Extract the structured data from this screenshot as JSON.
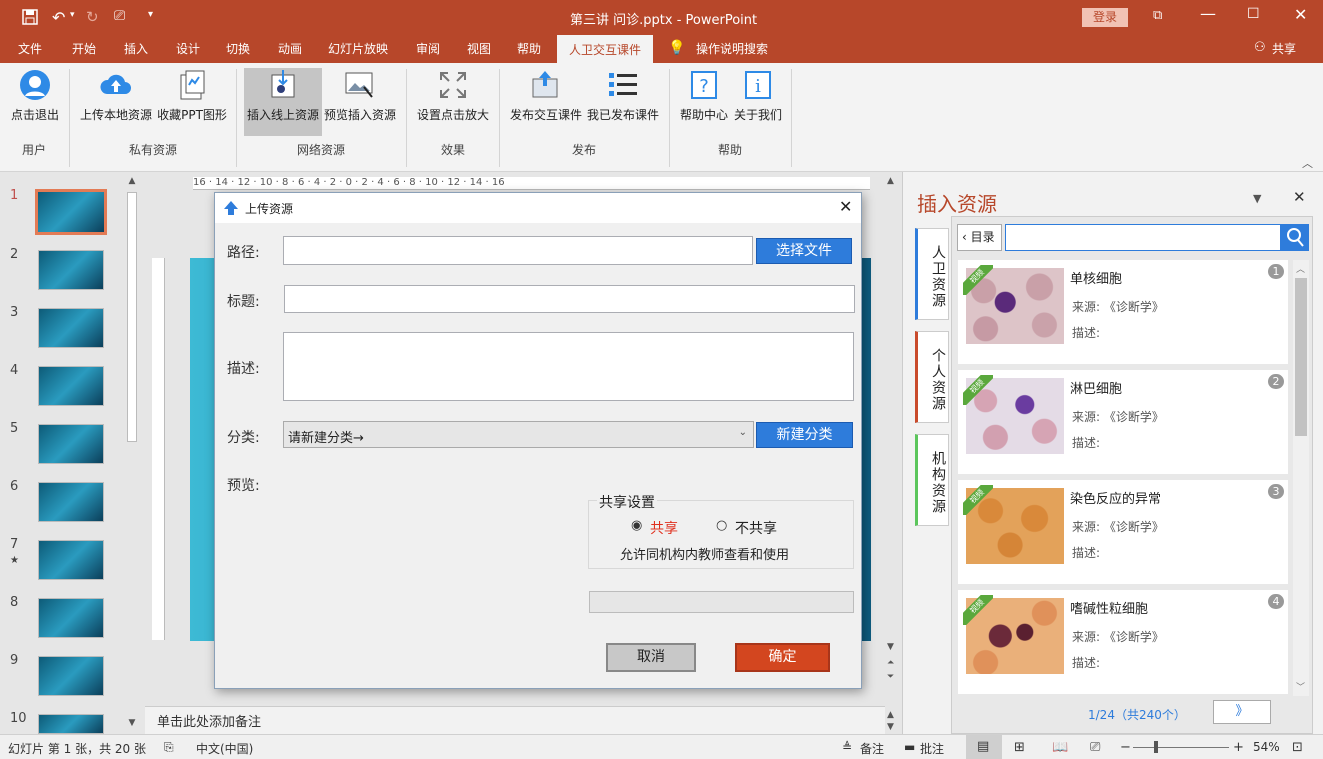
{
  "title_bar": {
    "title": "第三讲 问诊.pptx  -  PowerPoint",
    "login": "登录"
  },
  "tabs": [
    "文件",
    "开始",
    "插入",
    "设计",
    "切换",
    "动画",
    "幻灯片放映",
    "审阅",
    "视图",
    "帮助",
    "人卫交互课件"
  ],
  "tell_me": "操作说明搜索",
  "share": "共享",
  "ribbon": {
    "groups": [
      {
        "label": "用户",
        "buttons": [
          "点击退出"
        ]
      },
      {
        "label": "私有资源",
        "buttons": [
          "上传本地资源",
          "收藏PPT图形"
        ]
      },
      {
        "label": "网络资源",
        "buttons": [
          "插入线上资源",
          "预览插入资源"
        ]
      },
      {
        "label": "效果",
        "buttons": [
          "设置点击放大"
        ]
      },
      {
        "label": "发布",
        "buttons": [
          "发布交互课件",
          "我已发布课件"
        ]
      },
      {
        "label": "帮助",
        "buttons": [
          "帮助中心",
          "关于我们"
        ]
      }
    ]
  },
  "slides": [
    {
      "num": "1",
      "mark": ""
    },
    {
      "num": "2",
      "mark": ""
    },
    {
      "num": "3",
      "mark": ""
    },
    {
      "num": "4",
      "mark": ""
    },
    {
      "num": "5",
      "mark": ""
    },
    {
      "num": "6",
      "mark": ""
    },
    {
      "num": "7",
      "mark": "★"
    },
    {
      "num": "8",
      "mark": ""
    },
    {
      "num": "9",
      "mark": ""
    },
    {
      "num": "10",
      "mark": ""
    }
  ],
  "ruler_text": "16 · 14 · 12 · 10 · 8 · 6 · 4 · 2 · 0 · 2 · 4 · 6 · 8 · 10 · 12 · 14 · 16",
  "notes_placeholder": "单击此处添加备注",
  "dialog": {
    "title": "上传资源",
    "path_label": "路径:",
    "path_value": "",
    "choose_file": "选择文件",
    "title_label": "标题:",
    "title_value": "",
    "desc_label": "描述:",
    "desc_value": "",
    "category_label": "分类:",
    "category_value": "请新建分类→",
    "new_category": "新建分类",
    "preview_label": "预览:",
    "share_settings": "共享设置",
    "share_option": "共享",
    "noshare_option": "不共享",
    "share_hint": "允许同机构内教师查看和使用",
    "cancel": "取消",
    "ok": "确定",
    "progress": 0
  },
  "pane": {
    "title": "插入资源",
    "back": "目录",
    "search_value": "",
    "side_tabs": [
      {
        "label": "人卫资源",
        "color": "#2e7cdb"
      },
      {
        "label": "个人资源",
        "color": "#c94b2c"
      },
      {
        "label": "机构资源",
        "color": "#5cc65c"
      }
    ],
    "tag": "视频",
    "source_label": "来源:",
    "source_value": "《诊断学》",
    "desc_label": "描述:",
    "items": [
      {
        "num": "1",
        "title": "单核细胞"
      },
      {
        "num": "2",
        "title": "淋巴细胞"
      },
      {
        "num": "3",
        "title": "染色反应的异常"
      },
      {
        "num": "4",
        "title": "嗜碱性粒细胞"
      }
    ],
    "pagination": "1/24（共240个）",
    "next": "》"
  },
  "status": {
    "slide_info": "幻灯片 第 1 张，共 20 张",
    "language": "中文(中国)",
    "notes": "备注",
    "comments": "批注",
    "zoom": "54%"
  }
}
